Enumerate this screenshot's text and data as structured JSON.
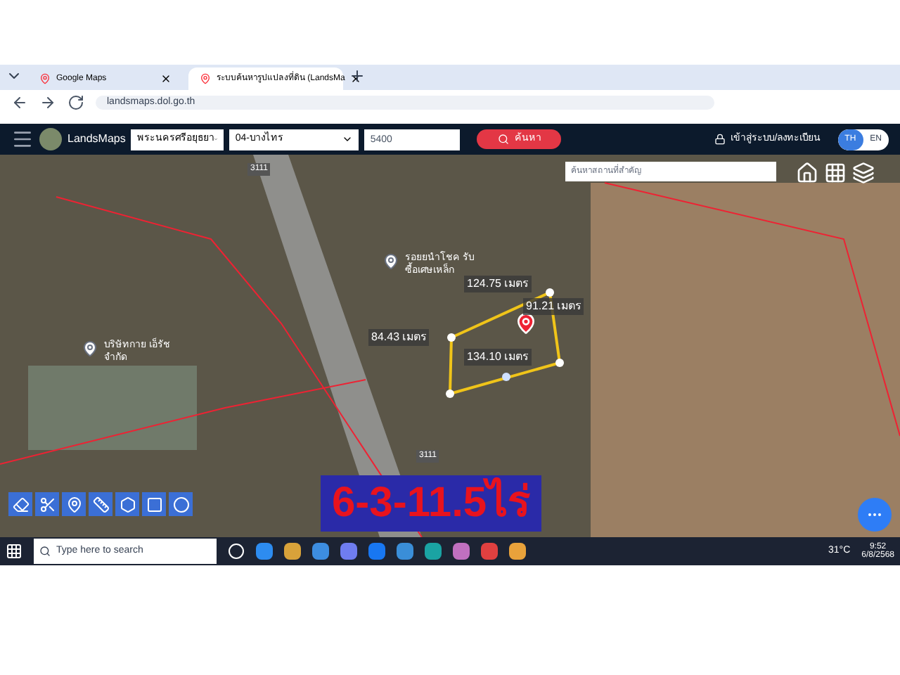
{
  "browser": {
    "tabs": [
      {
        "title": "Google Maps",
        "selected": false
      },
      {
        "title": "ระบบค้นหารูปแปลงที่ดิน (LandsMa",
        "selected": true
      }
    ],
    "address": "landsmaps.dol.go.th"
  },
  "header": {
    "brand": "LandsMaps",
    "province": "พระนครศรีอยุธยา",
    "district": "04-บางไทร",
    "parcel": "5400",
    "search_button": "ค้นหา",
    "login": "เข้าสู่ระบบ/ลงทะเบียน",
    "languages": [
      {
        "label": "TH",
        "selected": true
      },
      {
        "label": "EN",
        "selected": false
      }
    ]
  },
  "map": {
    "search_placeholder": "ค้นหาสถานที่สำคัญ",
    "places": [
      {
        "label": "รอยยนำโชค รับซื้อเศษเหล็ก"
      },
      {
        "label": "บริษัทกาย เอ็รัชจำกัด"
      }
    ],
    "road_labels": [
      "3111",
      "3111"
    ],
    "measurements": [
      "124.75 เมตร",
      "91.21 เมตร",
      "84.43 เมตร",
      "134.10 เมตร"
    ],
    "area_caption": "6-3-11.5ไร่"
  },
  "taskbar": {
    "search_placeholder": "Type here to search",
    "temperature": "31°C",
    "time": "9:52",
    "date": "6/8/2568"
  }
}
